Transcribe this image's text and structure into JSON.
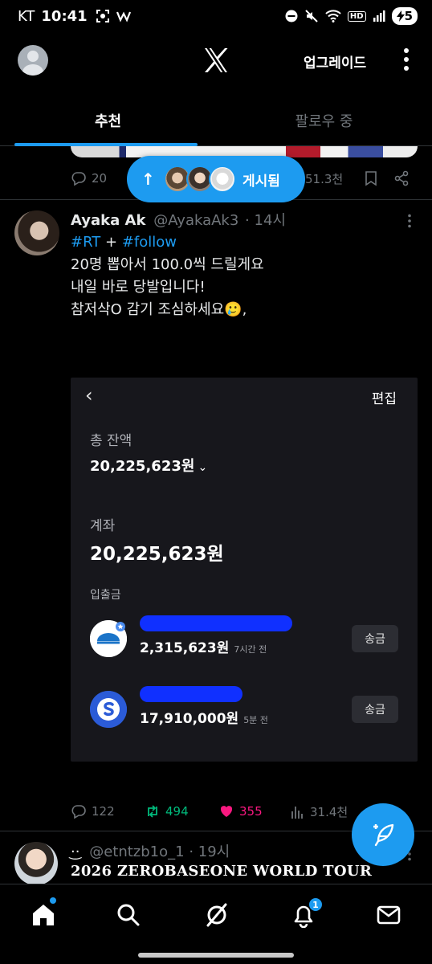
{
  "status_bar": {
    "carrier": "KT",
    "time": "10:41",
    "network_badge": "HD",
    "battery": "5"
  },
  "header": {
    "upgrade_label": "업그레이드"
  },
  "tabs": [
    {
      "label": "추천",
      "active": true
    },
    {
      "label": "팔로우 중",
      "active": false
    }
  ],
  "prev_tweet": {
    "replies": "20",
    "views": "51.3천"
  },
  "posted_pill": {
    "label": "게시됨"
  },
  "tweet": {
    "name": "Ayaka Ak",
    "handle": "@AyakaAk3",
    "time": "· 14시",
    "hashtag1": "#RT",
    "plus": "+",
    "hashtag2": "#follow",
    "line1": "20명 뽑아서 100.0씩 드릴게요",
    "line2": "내일 바로 당발입니다!",
    "line3": "참저삭O 감기 조심하세요🥲,",
    "replies": "122",
    "retweets": "494",
    "likes": "355",
    "views": "31.4천"
  },
  "bank": {
    "edit": "편집",
    "total_label": "총 잔액",
    "total": "20,225,623원",
    "account_label": "계좌",
    "account_total": "20,225,623원",
    "tx_label": "입출금",
    "rows": [
      {
        "amount": "2,315,623원",
        "ago": "7시간 전",
        "send": "송금"
      },
      {
        "amount": "17,910,000원",
        "ago": "5분 전",
        "send": "송금"
      }
    ]
  },
  "next_tweet": {
    "face": "·͜·",
    "handle": "@etntzb1o_1",
    "time": "· 19시",
    "text": "2026 ZEROBASEONE WORLD TOUR"
  },
  "bottom_nav": {
    "notif_badge": "1"
  },
  "colors": {
    "accent": "#1d9bf0",
    "retweet": "#00ba7c",
    "like": "#f91880",
    "muted": "#71767b",
    "background": "#000000"
  }
}
